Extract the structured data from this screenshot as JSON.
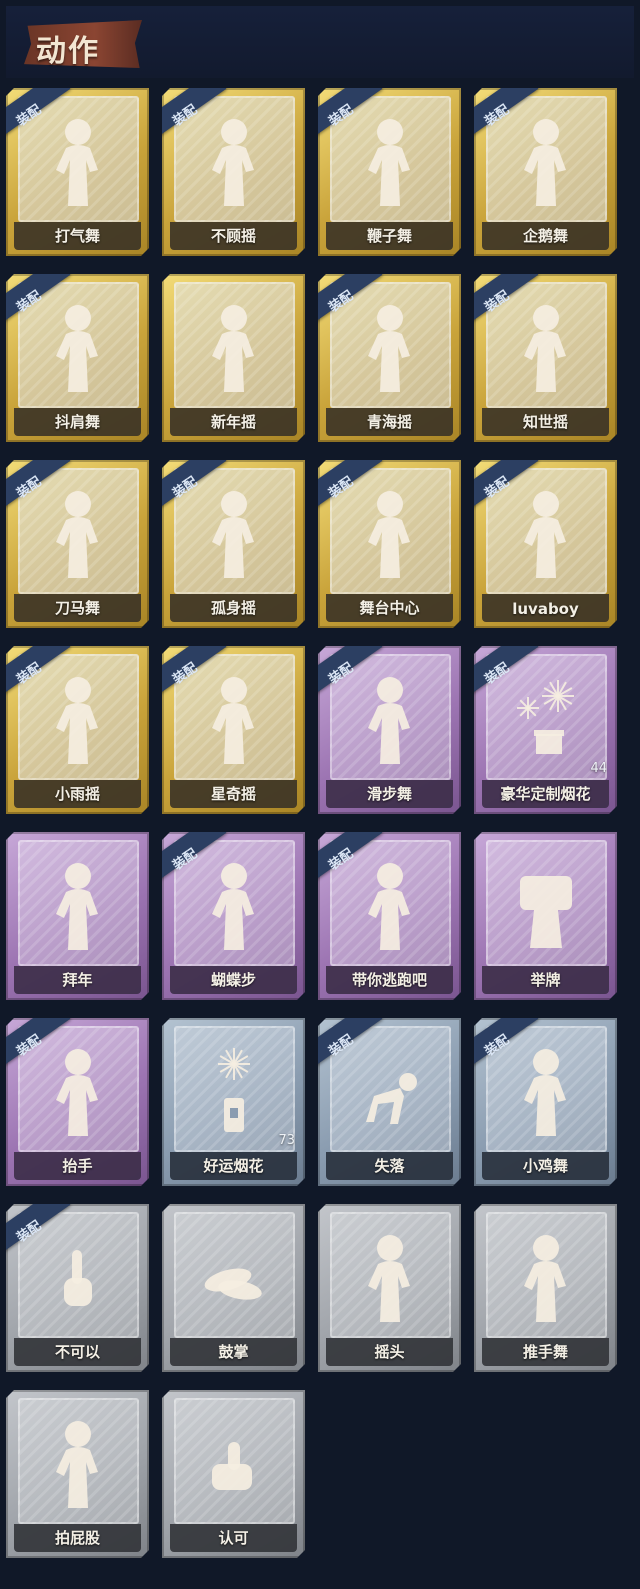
{
  "header": {
    "title": "动作"
  },
  "equip_label": "装配",
  "colors": {
    "gold": "#d4b04a",
    "purple": "#a57fbd",
    "blue": "#8fa1b4",
    "gray": "#a6a9ae",
    "equip_ribbon": "#2c3f62"
  },
  "actions": [
    {
      "label": "打气舞",
      "tier": "gold",
      "equipped": true,
      "icon": "dance-pose-icon"
    },
    {
      "label": "不顾摇",
      "tier": "gold",
      "equipped": true,
      "icon": "dance-pose-icon"
    },
    {
      "label": "鞭子舞",
      "tier": "gold",
      "equipped": true,
      "icon": "dance-pose-icon"
    },
    {
      "label": "企鹅舞",
      "tier": "gold",
      "equipped": true,
      "icon": "dance-pose-icon"
    },
    {
      "label": "抖肩舞",
      "tier": "gold",
      "equipped": true,
      "icon": "dance-pose-icon"
    },
    {
      "label": "新年摇",
      "tier": "gold",
      "equipped": false,
      "icon": "dance-pose-icon"
    },
    {
      "label": "青海摇",
      "tier": "gold",
      "equipped": true,
      "icon": "dance-pose-icon"
    },
    {
      "label": "知世摇",
      "tier": "gold",
      "equipped": true,
      "icon": "dance-pose-icon"
    },
    {
      "label": "刀马舞",
      "tier": "gold",
      "equipped": true,
      "icon": "dance-pose-icon"
    },
    {
      "label": "孤身摇",
      "tier": "gold",
      "equipped": true,
      "icon": "dance-pose-icon"
    },
    {
      "label": "舞台中心",
      "tier": "gold",
      "equipped": true,
      "icon": "dance-pose-icon"
    },
    {
      "label": "luvaboy",
      "tier": "gold",
      "equipped": true,
      "icon": "dance-pose-icon"
    },
    {
      "label": "小雨摇",
      "tier": "gold",
      "equipped": true,
      "icon": "dance-pose-icon"
    },
    {
      "label": "星奇摇",
      "tier": "gold",
      "equipped": true,
      "icon": "dance-pose-icon"
    },
    {
      "label": "滑步舞",
      "tier": "purple",
      "equipped": true,
      "icon": "dance-pose-icon"
    },
    {
      "label": "豪华定制烟花",
      "tier": "purple",
      "equipped": true,
      "icon": "fireworks-box-icon",
      "count": "44"
    },
    {
      "label": "拜年",
      "tier": "purple",
      "equipped": false,
      "icon": "greeting-pose-icon"
    },
    {
      "label": "蝴蝶步",
      "tier": "purple",
      "equipped": true,
      "icon": "dance-pose-icon"
    },
    {
      "label": "带你逃跑吧",
      "tier": "purple",
      "equipped": true,
      "icon": "dance-pose-icon"
    },
    {
      "label": "举牌",
      "tier": "purple",
      "equipped": false,
      "icon": "sign-holding-icon"
    },
    {
      "label": "抬手",
      "tier": "purple",
      "equipped": true,
      "icon": "raise-hand-icon"
    },
    {
      "label": "好运烟花",
      "tier": "blue",
      "equipped": false,
      "icon": "firework-tube-icon",
      "count": "73"
    },
    {
      "label": "失落",
      "tier": "blue",
      "equipped": true,
      "icon": "crawling-pose-icon"
    },
    {
      "label": "小鸡舞",
      "tier": "blue",
      "equipped": true,
      "icon": "dance-pose-icon"
    },
    {
      "label": "不可以",
      "tier": "gray",
      "equipped": true,
      "icon": "finger-wag-icon"
    },
    {
      "label": "鼓掌",
      "tier": "gray",
      "equipped": false,
      "icon": "clapping-hands-icon"
    },
    {
      "label": "摇头",
      "tier": "gray",
      "equipped": false,
      "icon": "head-shake-icon"
    },
    {
      "label": "推手舞",
      "tier": "gray",
      "equipped": false,
      "icon": "dance-pose-icon"
    },
    {
      "label": "拍屁股",
      "tier": "gray",
      "equipped": false,
      "icon": "bending-pose-icon"
    },
    {
      "label": "认可",
      "tier": "gray",
      "equipped": false,
      "icon": "thumbs-up-icon"
    }
  ]
}
